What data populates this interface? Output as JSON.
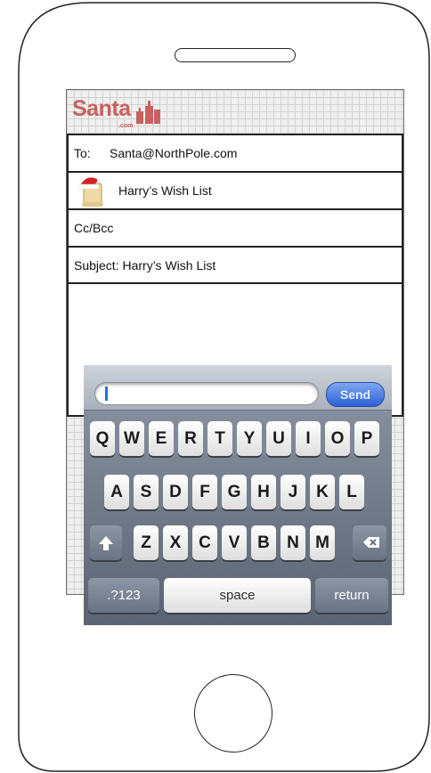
{
  "logo": {
    "text": "Santa",
    "sub": ".com"
  },
  "email": {
    "to_label": "To:",
    "to_value": "Santa@NorthPole.com",
    "from_value": "Harry’s Wish List",
    "cc_label": "Cc/Bcc",
    "subject": "Subject: Harry’s Wish List"
  },
  "keyboard": {
    "send_label": "Send",
    "row1": [
      "Q",
      "W",
      "E",
      "R",
      "T",
      "Y",
      "U",
      "I",
      "O",
      "P"
    ],
    "row2": [
      "A",
      "S",
      "D",
      "F",
      "G",
      "H",
      "J",
      "K",
      "L"
    ],
    "row3": [
      "Z",
      "X",
      "C",
      "V",
      "B",
      "N",
      "M"
    ],
    "numbers_label": ".?123",
    "space_label": "space",
    "return_label": "return"
  },
  "colors": {
    "logo": "#c9615f",
    "send": "#2d5fd8",
    "hat": "#d22222"
  }
}
